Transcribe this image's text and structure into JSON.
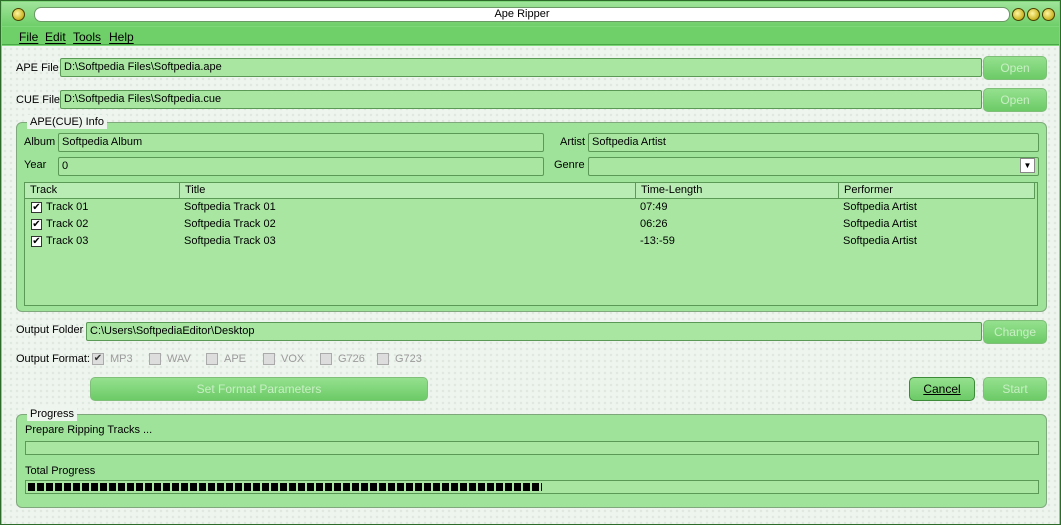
{
  "window": {
    "title": "Ape Ripper"
  },
  "menu": [
    "File",
    "Edit",
    "Tools",
    "Help"
  ],
  "ape_file": {
    "label": "APE File",
    "value": "D:\\Softpedia Files\\Softpedia.ape",
    "button": "Open"
  },
  "cue_file": {
    "label": "CUE File",
    "value": "D:\\Softpedia Files\\Softpedia.cue",
    "button": "Open"
  },
  "info": {
    "title": "APE(CUE) Info",
    "album_label": "Album",
    "album": "Softpedia Album",
    "artist_label": "Artist",
    "artist": "Softpedia Artist",
    "year_label": "Year",
    "year": "0",
    "genre_label": "Genre",
    "genre": ""
  },
  "tracks": {
    "headers": [
      "Track",
      "Title",
      "Time-Length",
      "Performer"
    ],
    "rows": [
      {
        "track": "Track 01",
        "title": "Softpedia Track 01",
        "time": "07:49",
        "performer": "Softpedia Artist",
        "checked": true
      },
      {
        "track": "Track 02",
        "title": "Softpedia Track 02",
        "time": "06:26",
        "performer": "Softpedia Artist",
        "checked": true
      },
      {
        "track": "Track 03",
        "title": "Softpedia Track 03",
        "time": "-13:-59",
        "performer": "Softpedia Artist",
        "checked": true
      }
    ]
  },
  "output": {
    "folder_label": "Output Folder",
    "folder": "C:\\Users\\SoftpediaEditor\\Desktop",
    "change_button": "Change",
    "format_label": "Output Format:",
    "formats": [
      {
        "name": "MP3",
        "checked": true
      },
      {
        "name": "WAV",
        "checked": false
      },
      {
        "name": "APE",
        "checked": false
      },
      {
        "name": "VOX",
        "checked": false
      },
      {
        "name": "G726",
        "checked": false
      },
      {
        "name": "G723",
        "checked": false
      }
    ],
    "params_button": "Set Format Parameters",
    "cancel_button": "Cancel",
    "start_button": "Start"
  },
  "progress": {
    "title": "Progress",
    "status": "Prepare Ripping Tracks ...",
    "track_progress": 0,
    "total_label": "Total Progress",
    "total_progress": 0.51
  },
  "colors": {
    "accent": "#7ed87a",
    "field": "#a8e6a2"
  }
}
